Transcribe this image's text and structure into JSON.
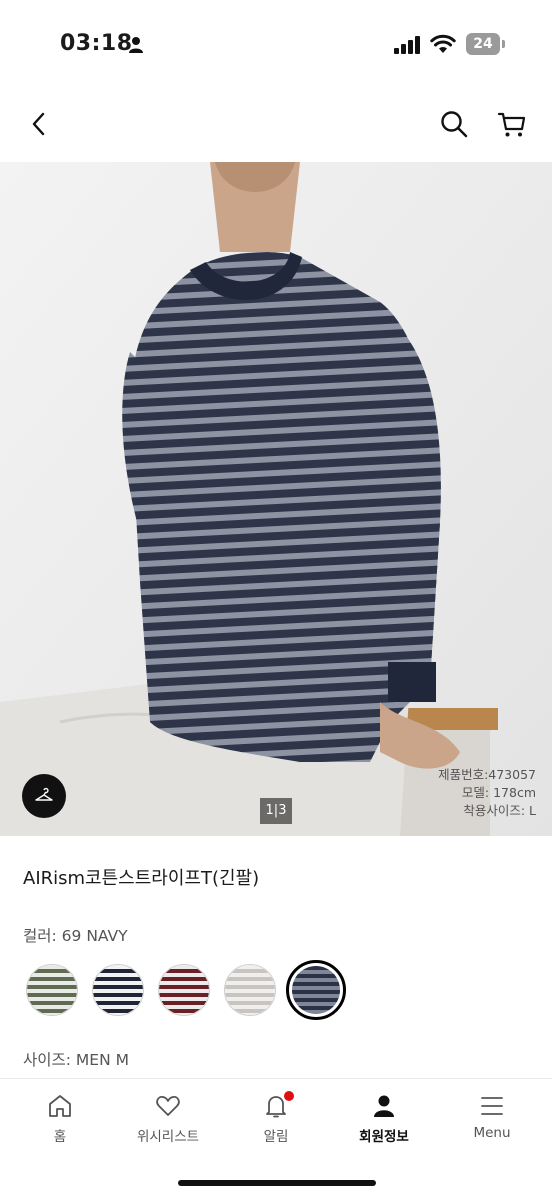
{
  "status_bar": {
    "time": "03:18",
    "battery": "24"
  },
  "header": {
    "back_icon": "chevron-left-icon",
    "search_icon": "search-icon",
    "cart_icon": "cart-icon"
  },
  "product_image": {
    "counter_current": "1",
    "counter_total": "3",
    "model_info": [
      "제품번호:473057",
      "모델: 178cm",
      "착용사이즈: L"
    ],
    "hanger_icon": "hanger-icon"
  },
  "product": {
    "name": "AIRism코튼스트라이프T(긴팔)",
    "color_label": "컬러: 69 NAVY",
    "size_label": "사이즈: MEN M",
    "swatches": [
      {
        "stripe": "#5f6b52",
        "base": "#e9e9e6",
        "selected": false
      },
      {
        "stripe": "#1f2536",
        "base": "#f2f2f2",
        "selected": false
      },
      {
        "stripe": "#6b1f27",
        "base": "#ecebeb",
        "selected": false
      },
      {
        "stripe": "#c8c5c0",
        "base": "#f0efed",
        "selected": false
      },
      {
        "stripe": "#7f8696",
        "base": "#2b3247",
        "selected": true
      }
    ]
  },
  "bottom_nav": {
    "items": [
      {
        "label": "홈",
        "icon": "home-icon",
        "active": false
      },
      {
        "label": "위시리스트",
        "icon": "heart-icon",
        "active": false
      },
      {
        "label": "알림",
        "icon": "bell-icon",
        "active": false,
        "badge": true
      },
      {
        "label": "회원정보",
        "icon": "person-icon",
        "active": true
      },
      {
        "label": "Menu",
        "icon": "menu-icon",
        "active": false
      }
    ]
  }
}
